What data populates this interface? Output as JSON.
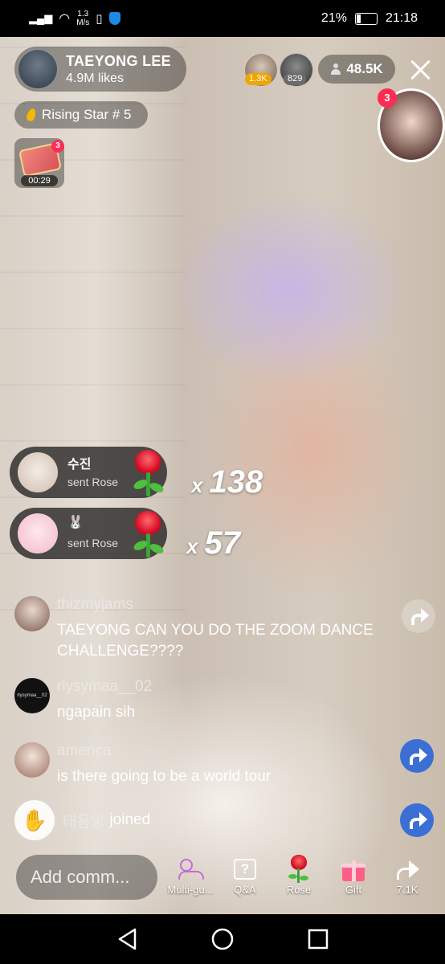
{
  "status_bar": {
    "speed_value": "1.3",
    "speed_unit": "M/s",
    "battery": "21%",
    "time": "21:18"
  },
  "host": {
    "name": "TAEYONG LEE",
    "likes": "4.9M likes"
  },
  "top_viewers": [
    {
      "badge": "1.3K",
      "badge_color": "#f0a500"
    },
    {
      "badge": "829",
      "badge_color": "#6b6b6b"
    }
  ],
  "viewer_count": "48.5K",
  "guest": {
    "badge": "3"
  },
  "rising_star": "Rising Star # 5",
  "treasure": {
    "badge": "3",
    "timer": "00:29"
  },
  "gifts": [
    {
      "name": "수진",
      "action": "sent Rose",
      "x": "x",
      "count": "138"
    },
    {
      "name": "🐰",
      "action": "sent Rose",
      "x": "x",
      "count": "57"
    }
  ],
  "comments": [
    {
      "user": "thizmyjams",
      "text_line1": "TAEYONG CAN YOU DO THE ZOOM DANCE",
      "text_line2": "CHALLENGE????"
    },
    {
      "user": "rlysymaa__02",
      "text_line1": "ngapain sih",
      "avatar_text": "rlysymaa__02"
    },
    {
      "user": "america",
      "text_line1": "is there going to be a world tour"
    }
  ],
  "joined": {
    "user": "태용앙",
    "text": "joined"
  },
  "bottom_bar": {
    "comment_placeholder": "Add comm...",
    "actions": [
      {
        "label": "Multi-gu..."
      },
      {
        "label": "Q&A"
      },
      {
        "label": "Rose"
      },
      {
        "label": "Gift"
      },
      {
        "label": "7.1K"
      }
    ]
  },
  "colors": {
    "accent_red": "#fe2c55",
    "share_blue": "#3b6fd6"
  }
}
